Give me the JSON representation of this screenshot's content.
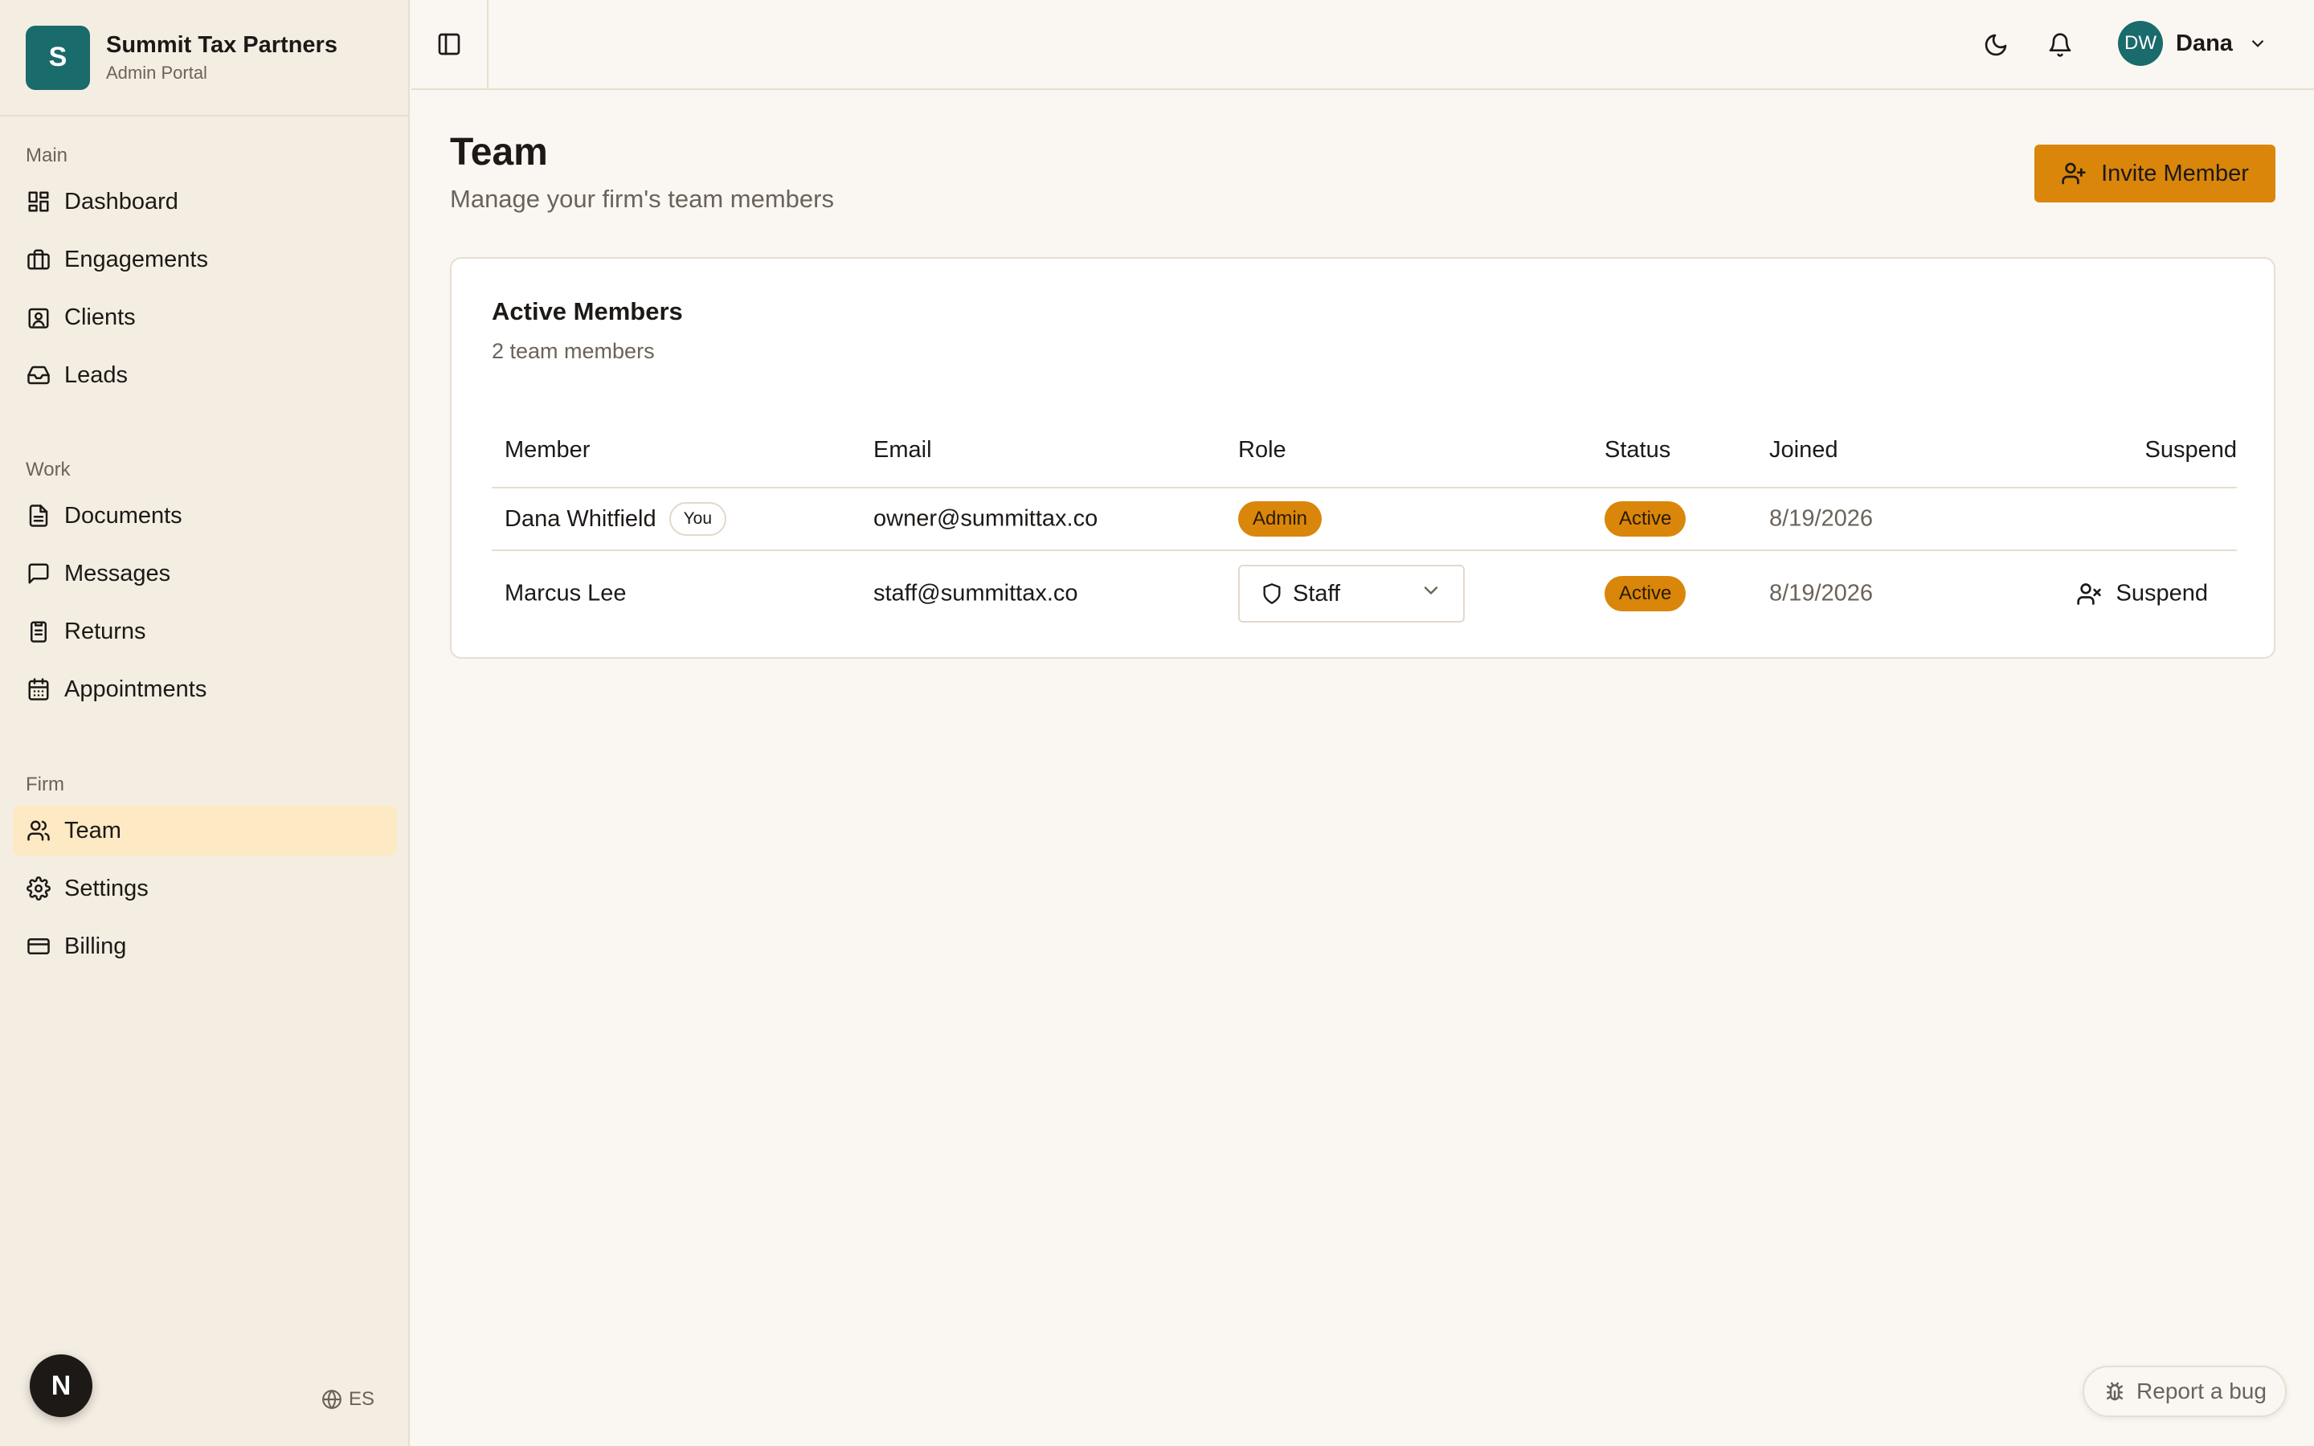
{
  "brand": {
    "logo_letter": "S",
    "name": "Summit Tax Partners",
    "subtitle": "Admin Portal"
  },
  "sidebar": {
    "sections": [
      {
        "heading": "Main",
        "items": [
          {
            "label": "Dashboard",
            "icon": "dashboard-icon"
          },
          {
            "label": "Engagements",
            "icon": "briefcase-icon"
          },
          {
            "label": "Clients",
            "icon": "contact-icon"
          },
          {
            "label": "Leads",
            "icon": "inbox-icon"
          }
        ]
      },
      {
        "heading": "Work",
        "items": [
          {
            "label": "Documents",
            "icon": "document-icon"
          },
          {
            "label": "Messages",
            "icon": "message-icon"
          },
          {
            "label": "Returns",
            "icon": "clipboard-icon"
          },
          {
            "label": "Appointments",
            "icon": "calendar-icon"
          }
        ]
      },
      {
        "heading": "Firm",
        "items": [
          {
            "label": "Team",
            "icon": "users-icon",
            "active": true
          },
          {
            "label": "Settings",
            "icon": "gear-icon"
          },
          {
            "label": "Billing",
            "icon": "credit-card-icon"
          }
        ]
      }
    ],
    "dev_badge": "N",
    "language": "ES"
  },
  "topbar": {
    "user_initials": "DW",
    "user_name": "Dana"
  },
  "page": {
    "title": "Team",
    "subtitle": "Manage your firm's team members",
    "invite_label": "Invite Member"
  },
  "members_card": {
    "title": "Active Members",
    "count_text": "2 team members",
    "columns": [
      "Member",
      "Email",
      "Role",
      "Status",
      "Joined",
      "Suspend"
    ],
    "rows": [
      {
        "name": "Dana Whitfield",
        "you_badge": "You",
        "email": "owner@summittax.co",
        "role": "Admin",
        "status": "Active",
        "joined": "8/19/2026"
      },
      {
        "name": "Marcus Lee",
        "email": "staff@summittax.co",
        "role": "Staff",
        "status": "Active",
        "joined": "8/19/2026",
        "suspend_label": "Suspend"
      }
    ]
  },
  "report_bug_label": "Report a bug",
  "colors": {
    "accent": "#d9860a",
    "brand_teal": "#1a6b6b",
    "active_nav_bg": "#fde9c4",
    "sidebar_bg": "#f4ede2"
  }
}
